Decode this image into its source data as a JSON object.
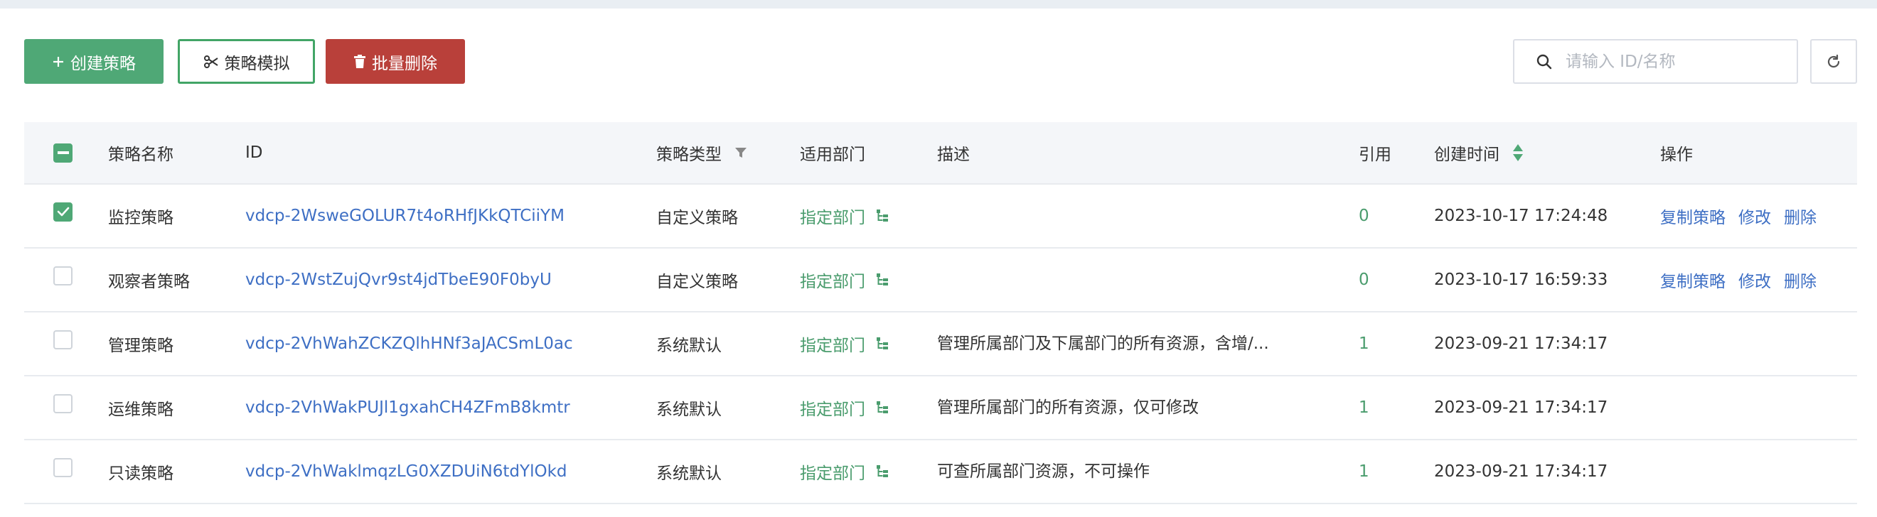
{
  "toolbar": {
    "create_label": "创建策略",
    "simulate_label": "策略模拟",
    "batch_delete_label": "批量删除",
    "search_placeholder": "请输入 ID/名称",
    "search_value": ""
  },
  "table": {
    "headers": {
      "name": "策略名称",
      "id": "ID",
      "type": "策略类型",
      "dept": "适用部门",
      "desc": "描述",
      "ref": "引用",
      "time": "创建时间",
      "ops": "操作"
    },
    "rows": [
      {
        "checked": true,
        "name": "监控策略",
        "id": "vdcp-2WsweGOLUR7t4oRHfJKkQTCiiYM",
        "type": "自定义策略",
        "dept": "指定部门",
        "desc": "",
        "ref": "0",
        "time": "2023-10-17 17:24:48",
        "ops": [
          "复制策略",
          "修改",
          "删除"
        ]
      },
      {
        "checked": false,
        "name": "观察者策略",
        "id": "vdcp-2WstZujQvr9st4jdTbeE90F0byU",
        "type": "自定义策略",
        "dept": "指定部门",
        "desc": "",
        "ref": "0",
        "time": "2023-10-17 16:59:33",
        "ops": [
          "复制策略",
          "修改",
          "删除"
        ]
      },
      {
        "checked": false,
        "name": "管理策略",
        "id": "vdcp-2VhWahZCKZQlhHNf3aJACSmL0ac",
        "type": "系统默认",
        "dept": "指定部门",
        "desc": "管理所属部门及下属部门的所有资源，含增/...",
        "ref": "1",
        "time": "2023-09-21 17:34:17",
        "ops": []
      },
      {
        "checked": false,
        "name": "运维策略",
        "id": "vdcp-2VhWakPUJl1gxahCH4ZFmB8kmtr",
        "type": "系统默认",
        "dept": "指定部门",
        "desc": "管理所属部门的所有资源，仅可修改",
        "ref": "1",
        "time": "2023-09-21 17:34:17",
        "ops": []
      },
      {
        "checked": false,
        "name": "只读策略",
        "id": "vdcp-2VhWaklmqzLG0XZDUiN6tdYlOkd",
        "type": "系统默认",
        "dept": "指定部门",
        "desc": "可查所属部门资源，不可操作",
        "ref": "1",
        "time": "2023-09-21 17:34:17",
        "ops": []
      }
    ]
  },
  "icons": {
    "create": "plus-icon",
    "simulate": "scissors-icon",
    "delete": "trash-icon",
    "search": "search-icon",
    "refresh": "refresh-icon",
    "filter": "filter-icon",
    "sort": "sort-icon",
    "dept_tree": "tree-icon"
  },
  "colors": {
    "primary": "#4fa876",
    "danger": "#b9403a",
    "link": "#3e6fc4",
    "dept_green": "#4a9c6d"
  }
}
